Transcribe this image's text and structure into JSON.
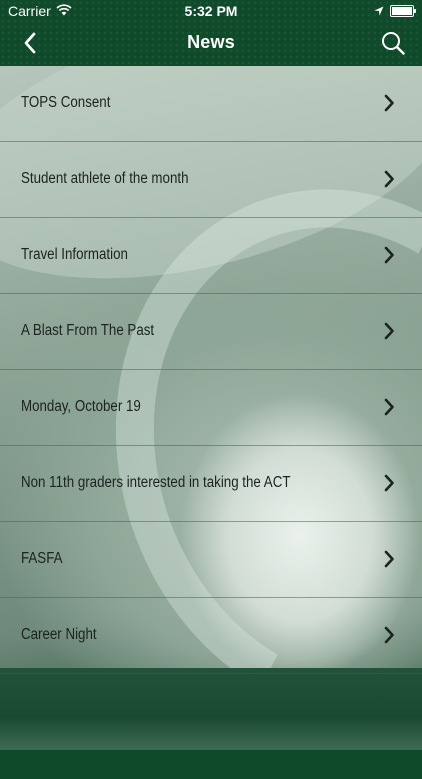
{
  "status_bar": {
    "carrier": "Carrier",
    "time": "5:32 PM",
    "battery_level": 1.0
  },
  "nav": {
    "title": "News"
  },
  "news_items": [
    {
      "label": "TOPS Consent"
    },
    {
      "label": "Student athlete of the month"
    },
    {
      "label": "Travel Information"
    },
    {
      "label": "A Blast From The Past"
    },
    {
      "label": "Monday, October 19"
    },
    {
      "label": "Non 11th graders interested in taking the ACT"
    },
    {
      "label": "FASFA"
    },
    {
      "label": "Career Night"
    }
  ],
  "colors": {
    "nav_background": "#0f4a2a",
    "row_text": "#1c2320"
  },
  "icons": {
    "back": "chevron-left-icon",
    "search": "search-icon",
    "row_disclosure": "chevron-right-icon"
  }
}
